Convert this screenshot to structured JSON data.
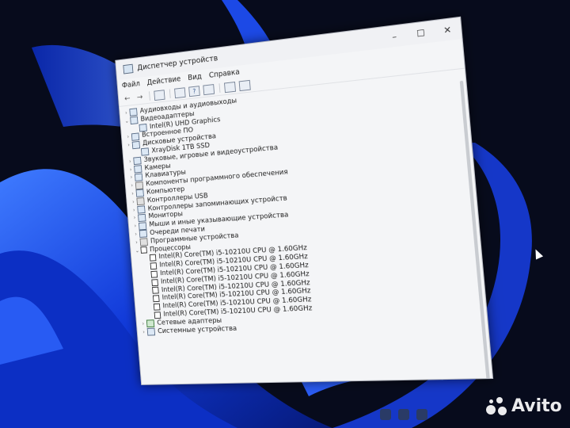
{
  "window": {
    "title": "Диспетчер устройств",
    "controls": [
      "–",
      "☐",
      "✕"
    ]
  },
  "menu": [
    "Файл",
    "Действие",
    "Вид",
    "Справка"
  ],
  "tree": [
    {
      "chev": "›",
      "indent": 0,
      "label": "Аудиовходы и аудиовыходы",
      "icon": "speaker-icon"
    },
    {
      "chev": "⌄",
      "indent": 0,
      "label": "Видеоадаптеры",
      "icon": "monitor-icon"
    },
    {
      "chev": "",
      "indent": 1,
      "label": "Intel(R) UHD Graphics",
      "icon": "monitor-icon"
    },
    {
      "chev": "›",
      "indent": 0,
      "label": "Встроенное ПО",
      "icon": "firmware-icon"
    },
    {
      "chev": "›",
      "indent": 0,
      "label": "Дисковые устройства",
      "icon": "disk-icon"
    },
    {
      "chev": "",
      "indent": 1,
      "label": "XrayDisk 1TB SSD",
      "icon": "disk-icon"
    },
    {
      "chev": "›",
      "indent": 0,
      "label": "Звуковые, игровые и видеоустройства",
      "icon": "speaker-icon"
    },
    {
      "chev": "›",
      "indent": 0,
      "label": "Камеры",
      "icon": "camera-icon"
    },
    {
      "chev": "›",
      "indent": 0,
      "label": "Клавиатуры",
      "icon": "keyboard-icon"
    },
    {
      "chev": "›",
      "indent": 0,
      "label": "Компоненты программного обеспечения",
      "icon": "software-icon"
    },
    {
      "chev": "›",
      "indent": 0,
      "label": "Компьютер",
      "icon": "computer-icon"
    },
    {
      "chev": "›",
      "indent": 0,
      "label": "Контроллеры USB",
      "icon": "usb-icon"
    },
    {
      "chev": "›",
      "indent": 0,
      "label": "Контроллеры запоминающих устройств",
      "icon": "storage-icon"
    },
    {
      "chev": "›",
      "indent": 0,
      "label": "Мониторы",
      "icon": "monitor-icon"
    },
    {
      "chev": "›",
      "indent": 0,
      "label": "Мыши и иные указывающие устройства",
      "icon": "mouse-icon"
    },
    {
      "chev": "›",
      "indent": 0,
      "label": "Очереди печати",
      "icon": "printer-icon"
    },
    {
      "chev": "›",
      "indent": 0,
      "label": "Программные устройства",
      "icon": "software-icon"
    },
    {
      "chev": "⌄",
      "indent": 0,
      "label": "Процессоры",
      "icon": "cpu-icon"
    },
    {
      "chev": "",
      "indent": 1,
      "label": "Intel(R) Core(TM) i5-10210U CPU @ 1.60GHz",
      "icon": "cpu-icon"
    },
    {
      "chev": "",
      "indent": 1,
      "label": "Intel(R) Core(TM) i5-10210U CPU @ 1.60GHz",
      "icon": "cpu-icon"
    },
    {
      "chev": "",
      "indent": 1,
      "label": "Intel(R) Core(TM) i5-10210U CPU @ 1.60GHz",
      "icon": "cpu-icon"
    },
    {
      "chev": "",
      "indent": 1,
      "label": "Intel(R) Core(TM) i5-10210U CPU @ 1.60GHz",
      "icon": "cpu-icon"
    },
    {
      "chev": "",
      "indent": 1,
      "label": "Intel(R) Core(TM) i5-10210U CPU @ 1.60GHz",
      "icon": "cpu-icon"
    },
    {
      "chev": "",
      "indent": 1,
      "label": "Intel(R) Core(TM) i5-10210U CPU @ 1.60GHz",
      "icon": "cpu-icon"
    },
    {
      "chev": "",
      "indent": 1,
      "label": "Intel(R) Core(TM) i5-10210U CPU @ 1.60GHz",
      "icon": "cpu-icon"
    },
    {
      "chev": "",
      "indent": 1,
      "label": "Intel(R) Core(TM) i5-10210U CPU @ 1.60GHz",
      "icon": "cpu-icon"
    },
    {
      "chev": "›",
      "indent": 0,
      "label": "Сетевые адаптеры",
      "icon": "network-icon"
    },
    {
      "chev": "›",
      "indent": 0,
      "label": "Системные устройства",
      "icon": "system-icon"
    }
  ],
  "watermark": "Avito",
  "colors": {
    "wallpaper_dark": "#070b1c",
    "wallpaper_blue": "#1e4fe0",
    "window_bg": "#f4f5f7"
  }
}
